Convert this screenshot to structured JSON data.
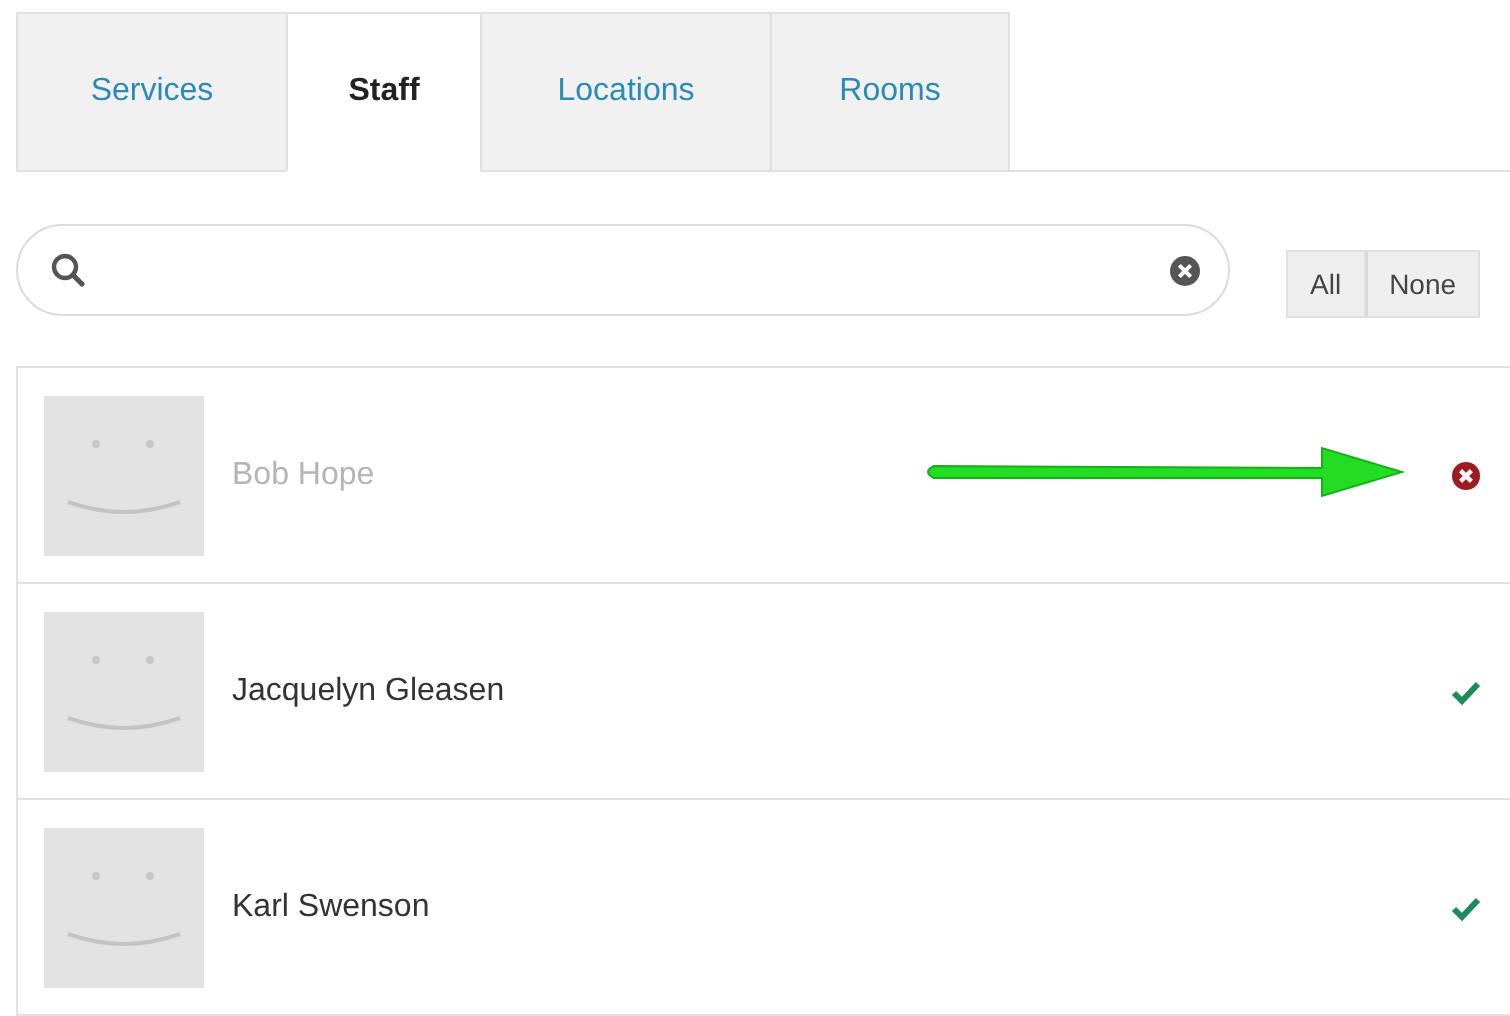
{
  "tabs": [
    {
      "label": "Services",
      "selected": false
    },
    {
      "label": "Staff",
      "selected": true
    },
    {
      "label": "Locations",
      "selected": false
    },
    {
      "label": "Rooms",
      "selected": false
    }
  ],
  "filter_buttons": [
    "All",
    "None"
  ],
  "staff": [
    {
      "name": "Bob Hope",
      "included": false,
      "arrow_pointing": true
    },
    {
      "name": "Jacquelyn Gleasen",
      "included": true,
      "arrow_pointing": false
    },
    {
      "name": "Karl Swenson",
      "included": true,
      "arrow_pointing": false
    }
  ]
}
